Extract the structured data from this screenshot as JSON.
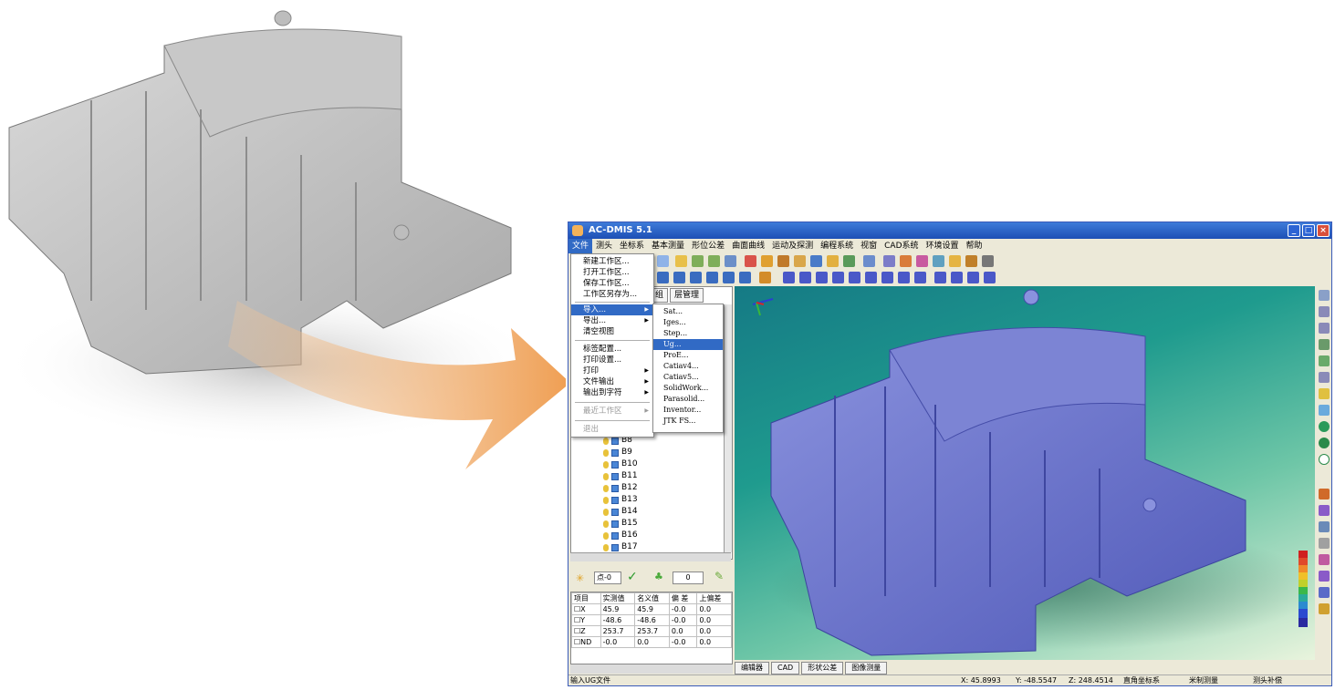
{
  "window": {
    "title": "AC-DMIS 5.1"
  },
  "menubar": [
    "文件",
    "测头",
    "坐标系",
    "基本测量",
    "形位公差",
    "曲面曲线",
    "运动及探测",
    "编程系统",
    "视窗",
    "CAD系统",
    "环境设置",
    "帮助"
  ],
  "file_menu": {
    "items": [
      {
        "label": "新建工作区..."
      },
      {
        "label": "打开工作区..."
      },
      {
        "label": "保存工作区..."
      },
      {
        "label": "工作区另存为..."
      },
      {
        "label": "导入..."
      },
      {
        "label": "导出..."
      },
      {
        "label": "清空视图"
      },
      {
        "label": "标签配置..."
      },
      {
        "label": "打印设置..."
      },
      {
        "label": "打印"
      },
      {
        "label": "文件输出"
      },
      {
        "label": "输出到字符"
      },
      {
        "label": "最近工作区"
      },
      {
        "label": "退出"
      }
    ]
  },
  "import_menu": {
    "items": [
      "Sat...",
      "Iges...",
      "Step...",
      "Ug...",
      "ProE...",
      "Catiav4...",
      "Catiav5...",
      "SolidWork...",
      "Parasolid...",
      "Inventor...",
      "JTK FS..."
    ]
  },
  "tree_tabs": [
    "组",
    "层管理"
  ],
  "tree_items": [
    "B8",
    "B9",
    "B10",
    "B11",
    "B12",
    "B13",
    "B14",
    "B15",
    "B16",
    "B17"
  ],
  "measure_toolbar": {
    "point_field": "点-0",
    "count_field": "0"
  },
  "measure_table": {
    "headers": [
      "项目",
      "实测值",
      "名义值",
      "偏 差",
      "上偏差"
    ],
    "rows": [
      [
        "X",
        "45.9",
        "45.9",
        "-0.0",
        "0.0"
      ],
      [
        "Y",
        "-48.6",
        "-48.6",
        "-0.0",
        "0.0"
      ],
      [
        "Z",
        "253.7",
        "253.7",
        "0.0",
        "0.0"
      ],
      [
        "ND",
        "-0.0",
        "0.0",
        "-0.0",
        "0.0"
      ]
    ]
  },
  "bottom_tabs": [
    "编辑器",
    "CAD",
    "形状公差",
    "图像测量"
  ],
  "status": {
    "message": "输入UG文件",
    "x": "X: 45.8993",
    "y": "Y: -48.5547",
    "z": "Z: 248.4514",
    "coord": "直角坐标系",
    "mode": "米制测量",
    "comp": "测头补偿"
  },
  "colors": {
    "accent": "#316ac5",
    "part_blue": "#6f78cc",
    "arrow_orange": "#f2a35a"
  }
}
